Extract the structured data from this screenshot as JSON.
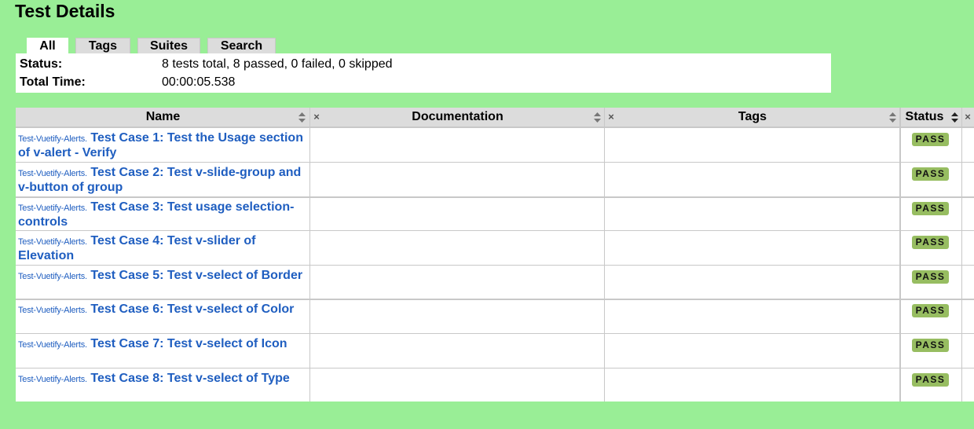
{
  "page_title": "Test Details",
  "tabs": [
    {
      "label": "All",
      "active": true
    },
    {
      "label": "Tags",
      "active": false
    },
    {
      "label": "Suites",
      "active": false
    },
    {
      "label": "Search",
      "active": false
    }
  ],
  "stats": {
    "status_label": "Status:",
    "status_value": "8 tests total, 8 passed, 0 failed, 0 skipped",
    "time_label": "Total Time:",
    "time_value": "00:00:05.538"
  },
  "table": {
    "columns": [
      "Name",
      "Documentation",
      "Tags",
      "Status"
    ],
    "rows": [
      {
        "parent": "Test-Vuetify-Alerts",
        "sep": ".",
        "name": "Test Case 1: Test the Usage section of v-alert - Verify",
        "status": "PASS"
      },
      {
        "parent": "Test-Vuetify-Alerts",
        "sep": ".",
        "name": "Test Case 2: Test v-slide-group and v-button of group",
        "status": "PASS"
      },
      {
        "parent": "Test-Vuetify-Alerts",
        "sep": ".",
        "name": "Test Case 3: Test usage selection-controls",
        "status": "PASS"
      },
      {
        "parent": "Test-Vuetify-Alerts",
        "sep": ".",
        "name": "Test Case 4: Test v-slider of Elevation",
        "status": "PASS"
      },
      {
        "parent": "Test-Vuetify-Alerts",
        "sep": ".",
        "name": "Test Case 5: Test v-select of Border",
        "status": "PASS"
      },
      {
        "parent": "Test-Vuetify-Alerts",
        "sep": ".",
        "name": "Test Case 6: Test v-select of Color",
        "status": "PASS"
      },
      {
        "parent": "Test-Vuetify-Alerts",
        "sep": ".",
        "name": "Test Case 7: Test v-select of Icon",
        "status": "PASS"
      },
      {
        "parent": "Test-Vuetify-Alerts",
        "sep": ".",
        "name": "Test Case 8: Test v-select of Type",
        "status": "PASS"
      }
    ]
  },
  "icons": {
    "sort": "sort-arrows-icon",
    "remove_column": "close-icon"
  },
  "colors": {
    "background": "#99ee96",
    "link": "#1f5ec0",
    "pass_badge": "#97bd61"
  }
}
